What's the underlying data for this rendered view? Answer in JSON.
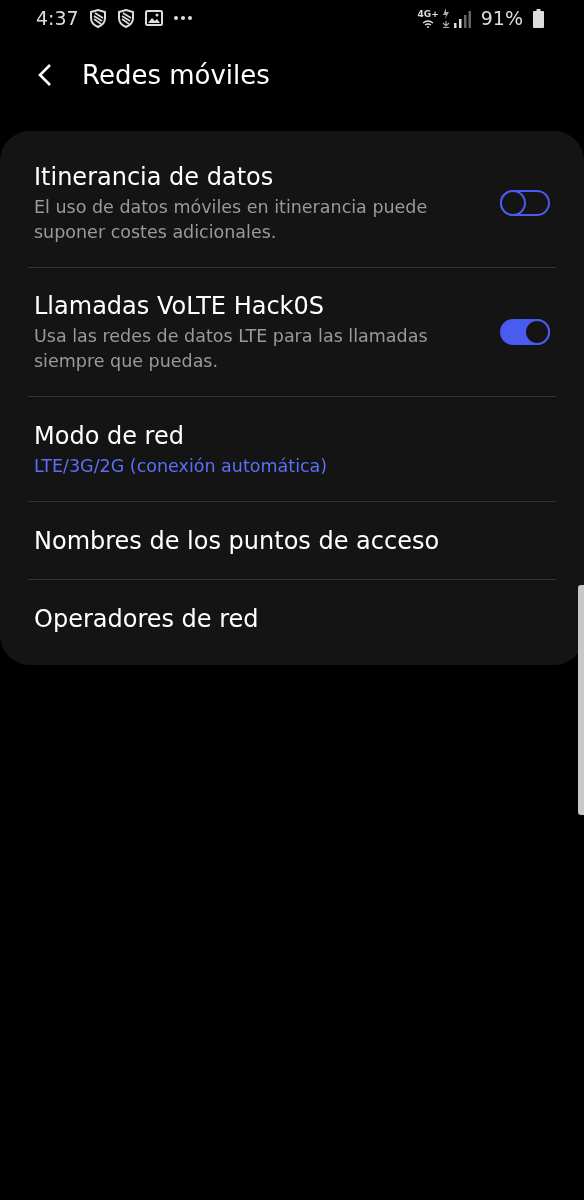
{
  "status_bar": {
    "time": "4:37",
    "network": "4G+",
    "battery": "91%"
  },
  "header": {
    "title": "Redes móviles"
  },
  "settings": [
    {
      "kind": "toggle",
      "title": "Itinerancia de datos",
      "subtitle": "El uso de datos móviles en itinerancia puede suponer costes adicionales.",
      "on": false
    },
    {
      "kind": "toggle",
      "title": "Llamadas VoLTE Hack0S",
      "subtitle": "Usa las redes de datos LTE para las llamadas siempre que puedas.",
      "on": true
    },
    {
      "kind": "value",
      "title": "Modo de red",
      "value": "LTE/3G/2G (conexión automática)"
    },
    {
      "kind": "plain",
      "title": "Nombres de los puntos de acceso"
    },
    {
      "kind": "plain",
      "title": "Operadores de red"
    }
  ]
}
